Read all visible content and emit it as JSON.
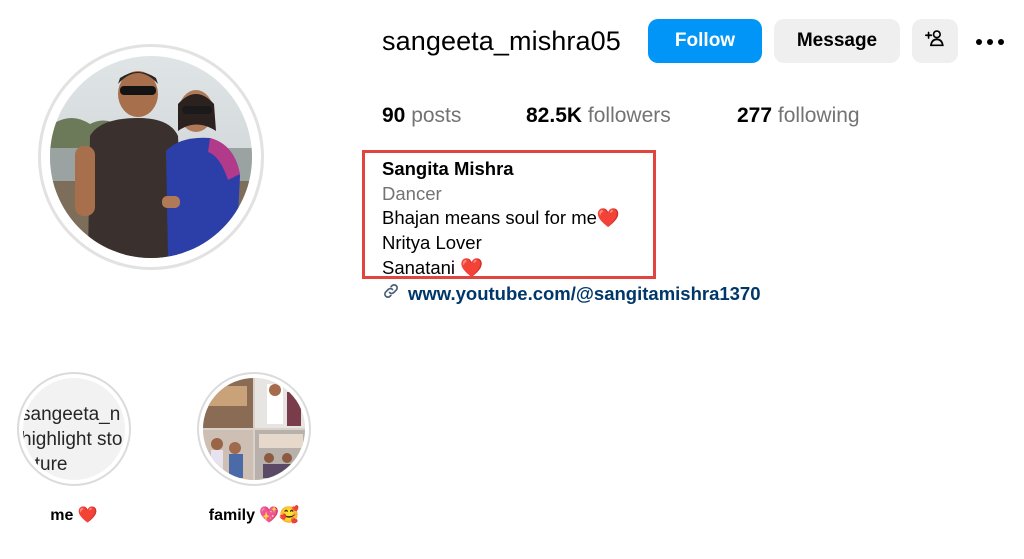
{
  "profile": {
    "username": "sangeeta_mishra05",
    "follow_label": "Follow",
    "message_label": "Message",
    "add_user_icon": "add-user-icon",
    "more_icon": "more-icon"
  },
  "stats": {
    "posts_count": "90",
    "posts_label": "posts",
    "followers_count": "82.5K",
    "followers_label": "followers",
    "following_count": "277",
    "following_label": "following"
  },
  "bio": {
    "name": "Sangita Mishra",
    "category": "Dancer",
    "lines": [
      "Bhajan means soul for me❤️",
      "Nritya Lover",
      "Sanatani ❤️"
    ],
    "link": "www.youtube.com/@sangitamishra1370",
    "highlight_box_color": "#e0463f"
  },
  "highlights": [
    {
      "label": "me ❤️",
      "broken_image_alt": [
        "sangeeta_n",
        "highlight sto",
        "icture"
      ]
    },
    {
      "label": "family 💖🥰"
    }
  ],
  "colors": {
    "follow_blue": "#0095f6",
    "link_blue": "#00376b",
    "secondary_gray": "#737373"
  }
}
